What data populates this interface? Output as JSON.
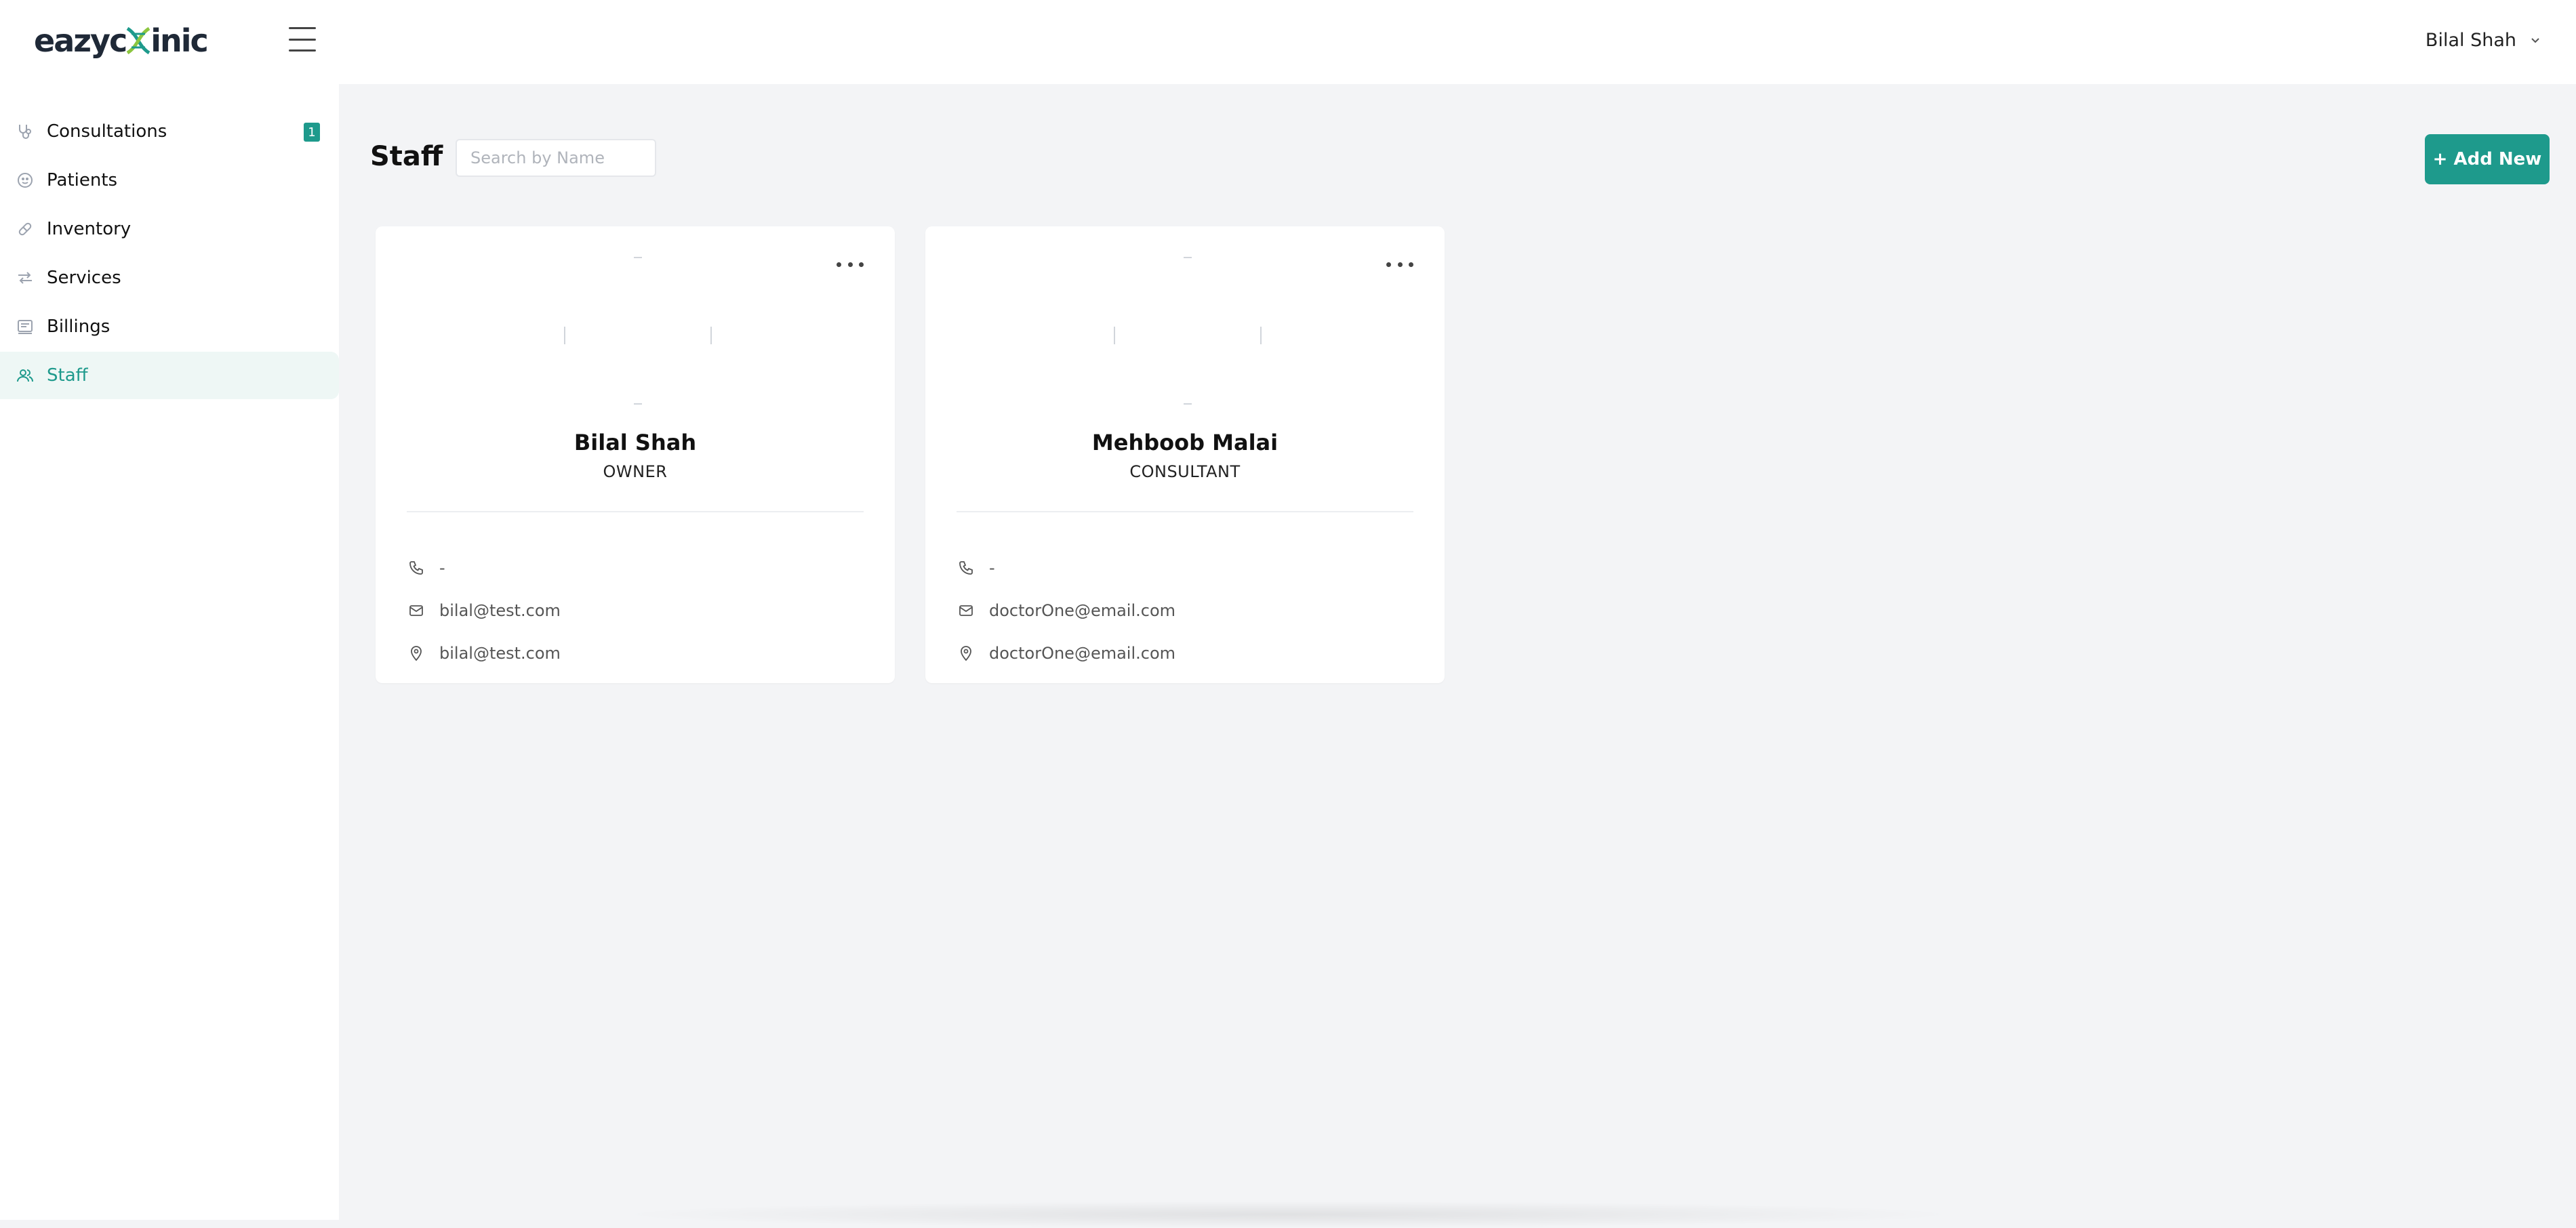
{
  "app": {
    "logo_text_left": "eazyc",
    "logo_text_right": "inic"
  },
  "header": {
    "user_name": "Bilal Shah"
  },
  "sidebar": {
    "items": [
      {
        "label": "Consultations",
        "icon": "stethoscope-icon",
        "badge": "1",
        "active": false
      },
      {
        "label": "Patients",
        "icon": "smiley-face-icon",
        "active": false
      },
      {
        "label": "Inventory",
        "icon": "pill-icon",
        "active": false
      },
      {
        "label": "Services",
        "icon": "arrows-exchange-icon",
        "active": false
      },
      {
        "label": "Billings",
        "icon": "invoice-icon",
        "active": false
      },
      {
        "label": "Staff",
        "icon": "users-icon",
        "active": true
      }
    ]
  },
  "main": {
    "title": "Staff",
    "search_placeholder": "Search by Name",
    "add_button_label": "+ Add New",
    "staff": [
      {
        "name": "Bilal Shah",
        "role": "OWNER",
        "phone": "-",
        "email": "bilal@test.com",
        "address": "bilal@test.com"
      },
      {
        "name": "Mehboob Malai",
        "role": "CONSULTANT",
        "phone": "-",
        "email": "doctorOne@email.com",
        "address": "doctorOne@email.com"
      }
    ]
  },
  "colors": {
    "accent": "#1e9a8c",
    "page_bg": "#f3f4f6",
    "active_bg": "#eef7f5"
  }
}
